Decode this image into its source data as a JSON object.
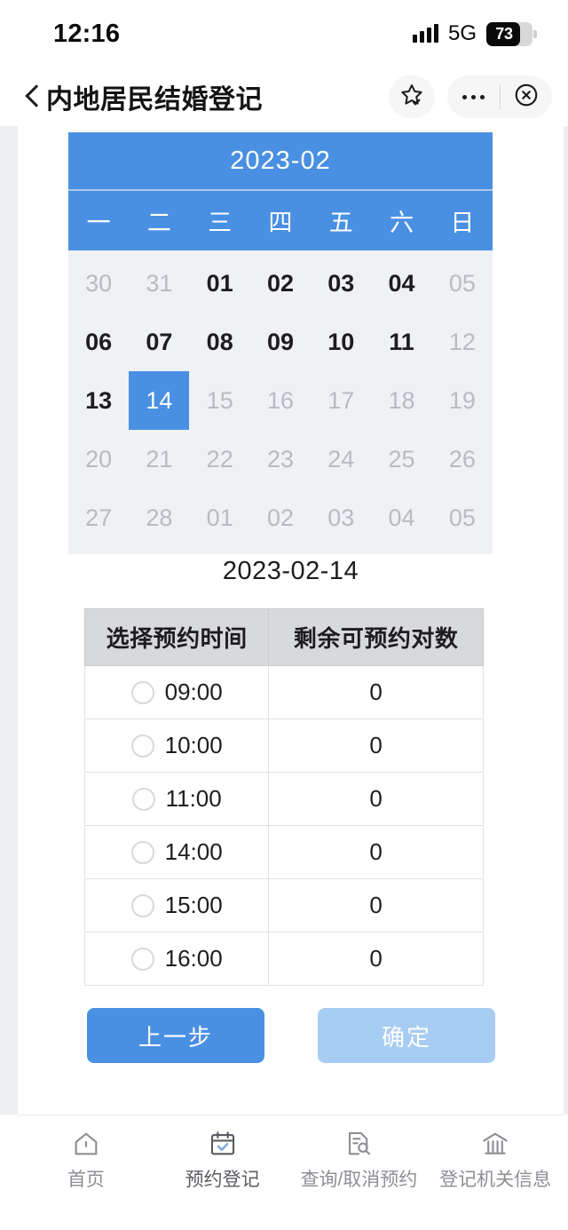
{
  "status_bar": {
    "time": "12:16",
    "network": "5G",
    "battery_percent": "73",
    "signal_icon": "signal-bars-icon",
    "battery_icon": "battery-icon"
  },
  "nav_bar": {
    "back_icon": "back-chevron-icon",
    "title": "内地居民结婚登记",
    "favorite_icon": "star-check-icon",
    "more_icon": "more-dots-icon",
    "close_icon": "close-circle-icon"
  },
  "calendar": {
    "month_title": "2023-02",
    "weekdays": [
      "一",
      "二",
      "三",
      "四",
      "五",
      "六",
      "日"
    ],
    "rows": [
      [
        {
          "day": "30",
          "state": "disabled"
        },
        {
          "day": "31",
          "state": "disabled"
        },
        {
          "day": "01",
          "state": "enabled"
        },
        {
          "day": "02",
          "state": "enabled"
        },
        {
          "day": "03",
          "state": "enabled"
        },
        {
          "day": "04",
          "state": "enabled"
        },
        {
          "day": "05",
          "state": "disabled"
        }
      ],
      [
        {
          "day": "06",
          "state": "enabled"
        },
        {
          "day": "07",
          "state": "enabled"
        },
        {
          "day": "08",
          "state": "enabled"
        },
        {
          "day": "09",
          "state": "enabled"
        },
        {
          "day": "10",
          "state": "enabled"
        },
        {
          "day": "11",
          "state": "enabled"
        },
        {
          "day": "12",
          "state": "disabled"
        }
      ],
      [
        {
          "day": "13",
          "state": "enabled"
        },
        {
          "day": "14",
          "state": "selected"
        },
        {
          "day": "15",
          "state": "disabled"
        },
        {
          "day": "16",
          "state": "disabled"
        },
        {
          "day": "17",
          "state": "disabled"
        },
        {
          "day": "18",
          "state": "disabled"
        },
        {
          "day": "19",
          "state": "disabled"
        }
      ],
      [
        {
          "day": "20",
          "state": "disabled"
        },
        {
          "day": "21",
          "state": "disabled"
        },
        {
          "day": "22",
          "state": "disabled"
        },
        {
          "day": "23",
          "state": "disabled"
        },
        {
          "day": "24",
          "state": "disabled"
        },
        {
          "day": "25",
          "state": "disabled"
        },
        {
          "day": "26",
          "state": "disabled"
        }
      ],
      [
        {
          "day": "27",
          "state": "disabled"
        },
        {
          "day": "28",
          "state": "disabled"
        },
        {
          "day": "01",
          "state": "disabled"
        },
        {
          "day": "02",
          "state": "disabled"
        },
        {
          "day": "03",
          "state": "disabled"
        },
        {
          "day": "04",
          "state": "disabled"
        },
        {
          "day": "05",
          "state": "disabled"
        }
      ]
    ],
    "header_color": "#4a90e2",
    "selected_color": "#4a90e2",
    "body_color": "#eff1f4"
  },
  "selected_date": "2023-02-14",
  "slot_table": {
    "headers": [
      "选择预约时间",
      "剩余可预约对数"
    ],
    "rows": [
      {
        "time": "09:00",
        "remaining": "0",
        "selected": false
      },
      {
        "time": "10:00",
        "remaining": "0",
        "selected": false
      },
      {
        "time": "11:00",
        "remaining": "0",
        "selected": false
      },
      {
        "time": "14:00",
        "remaining": "0",
        "selected": false
      },
      {
        "time": "15:00",
        "remaining": "0",
        "selected": false
      },
      {
        "time": "16:00",
        "remaining": "0",
        "selected": false
      }
    ]
  },
  "buttons": {
    "prev_label": "上一步",
    "confirm_label": "确定",
    "prev_color": "#4a90e2",
    "confirm_color": "#a8cdf2"
  },
  "tab_bar": {
    "items": [
      {
        "label": "首页",
        "icon": "home-icon",
        "active": false
      },
      {
        "label": "预约登记",
        "icon": "calendar-check-icon",
        "active": true
      },
      {
        "label": "查询/取消预约",
        "icon": "document-search-icon",
        "active": false
      },
      {
        "label": "登记机关信息",
        "icon": "institution-icon",
        "active": false
      }
    ]
  }
}
